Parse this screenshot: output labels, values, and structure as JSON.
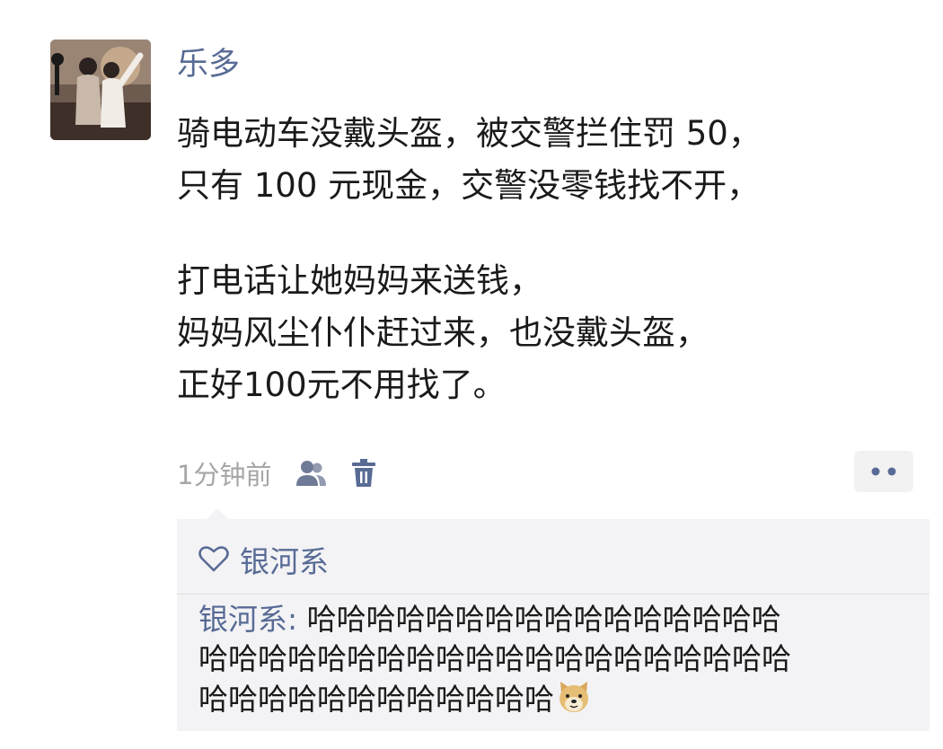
{
  "post": {
    "username": "乐多",
    "lines": [
      "骑电动车没戴头盔，被交警拦住罚 50，",
      "只有 100 元现金，交警没零钱找不开，",
      "打电话让她妈妈来送钱，",
      "妈妈风尘仆仆赶过来，也没戴头盔，",
      "正好100元不用找了。"
    ],
    "timestamp": "1分钟前"
  },
  "icons": {
    "visibility": "people-icon",
    "delete": "trash-icon",
    "more": "more-dots-icon",
    "like": "heart-outline-icon",
    "emoji": "doge-emoji-icon"
  },
  "likes": {
    "names": "银河系"
  },
  "comment": {
    "author": "银河系",
    "separator": ": ",
    "line1": "哈哈哈哈哈哈哈哈哈哈哈哈哈哈哈哈",
    "line2": "哈哈哈哈哈哈哈哈哈哈哈哈哈哈哈哈哈哈哈哈",
    "line3": "哈哈哈哈哈哈哈哈哈哈哈哈"
  },
  "colors": {
    "name_link": "#586b95",
    "body_text": "#1a1a1a",
    "meta_text": "#a6a6a6",
    "panel_bg": "#f3f3f5"
  }
}
